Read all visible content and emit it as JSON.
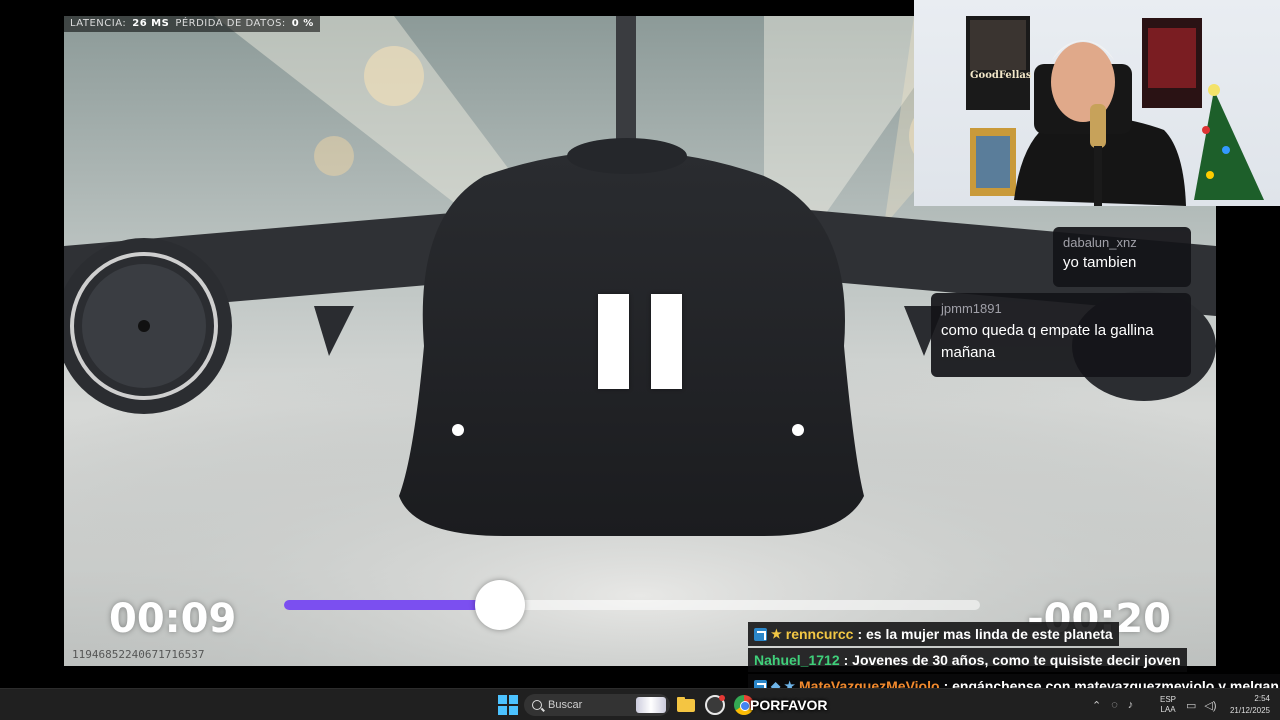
{
  "hud": {
    "latency_label": "LATENCIA:",
    "latency_value": "26 MS",
    "loss_label": "PÉRDIDA DE DATOS:",
    "loss_value": "0 %"
  },
  "session_id": "11946852240671716537",
  "player": {
    "current_time": "00:09",
    "remaining_time": "-00:20",
    "progress": 0.31,
    "state": "paused"
  },
  "chat_popups": [
    {
      "user": "dabalun_xnz",
      "message": "yo tambien"
    },
    {
      "user": "jpmm1891",
      "message": "como queda q empate la gallina mañana"
    }
  ],
  "chat_lines": [
    {
      "user": "renncurcc",
      "text": ": es la mujer mas linda de este planeta",
      "color": "#f2c744",
      "badges": [
        "b",
        "star"
      ]
    },
    {
      "user": "Nahuel_1712",
      "text": ": Jovenes de 30 años, como te quisiste decir joven",
      "color": "#3fd07a",
      "badges": []
    },
    {
      "user": "MateVazquezMeViolo",
      "text": ": engánchense con matevazquezmeviolo y melgan",
      "color": "#f28a2e",
      "badges": [
        "b",
        "shield",
        "star"
      ]
    }
  ],
  "overlay_caption": "PORFAVOR",
  "webcam": {
    "poster_left": "GoodFellas"
  },
  "taskbar": {
    "search_placeholder": "Buscar",
    "lang_top": "ESP",
    "lang_bottom": "LAA",
    "time": "2:54",
    "date": "21/12/2025"
  },
  "colors": {
    "progress_fill": "#7b4ff0",
    "taskbar_bg": "#202020"
  }
}
